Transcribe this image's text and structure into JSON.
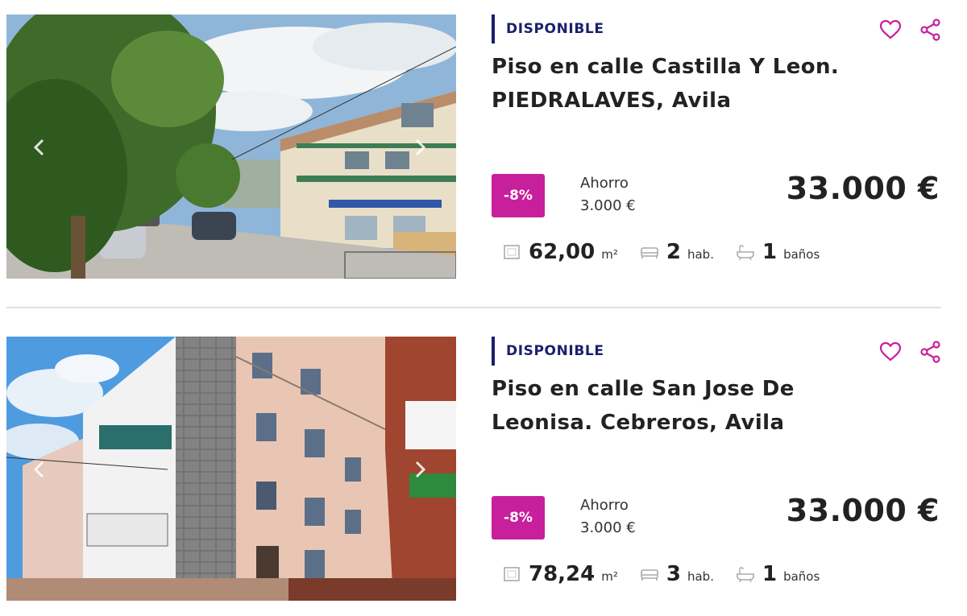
{
  "listings": [
    {
      "status": "DISPONIBLE",
      "title_line1": "Piso en calle Castilla Y Leon.",
      "title_line2": "PIEDRALAVES, Avila",
      "discount": "-8%",
      "savings_label": "Ahorro",
      "savings_value": "3.000 €",
      "price": "33.000 €",
      "area_value": "62,00",
      "area_unit": "m²",
      "rooms_value": "2",
      "rooms_unit": "hab.",
      "baths_value": "1",
      "baths_unit": "baños"
    },
    {
      "status": "DISPONIBLE",
      "title_line1": "Piso en calle San Jose De",
      "title_line2": "Leonisa. Cebreros, Avila",
      "discount": "-8%",
      "savings_label": "Ahorro",
      "savings_value": "3.000 €",
      "price": "33.000 €",
      "area_value": "78,24",
      "area_unit": "m²",
      "rooms_value": "3",
      "rooms_unit": "hab.",
      "baths_value": "1",
      "baths_unit": "baños"
    }
  ],
  "icons": {
    "favorite": "heart-icon",
    "share": "share-icon",
    "area": "floorplan-icon",
    "rooms": "bed-icon",
    "baths": "bathtub-icon",
    "prev": "chevron-left-icon",
    "next": "chevron-right-icon"
  },
  "colors": {
    "accent": "#c81f9c",
    "status": "#1a1f6b",
    "divider": "#dde0ea"
  }
}
